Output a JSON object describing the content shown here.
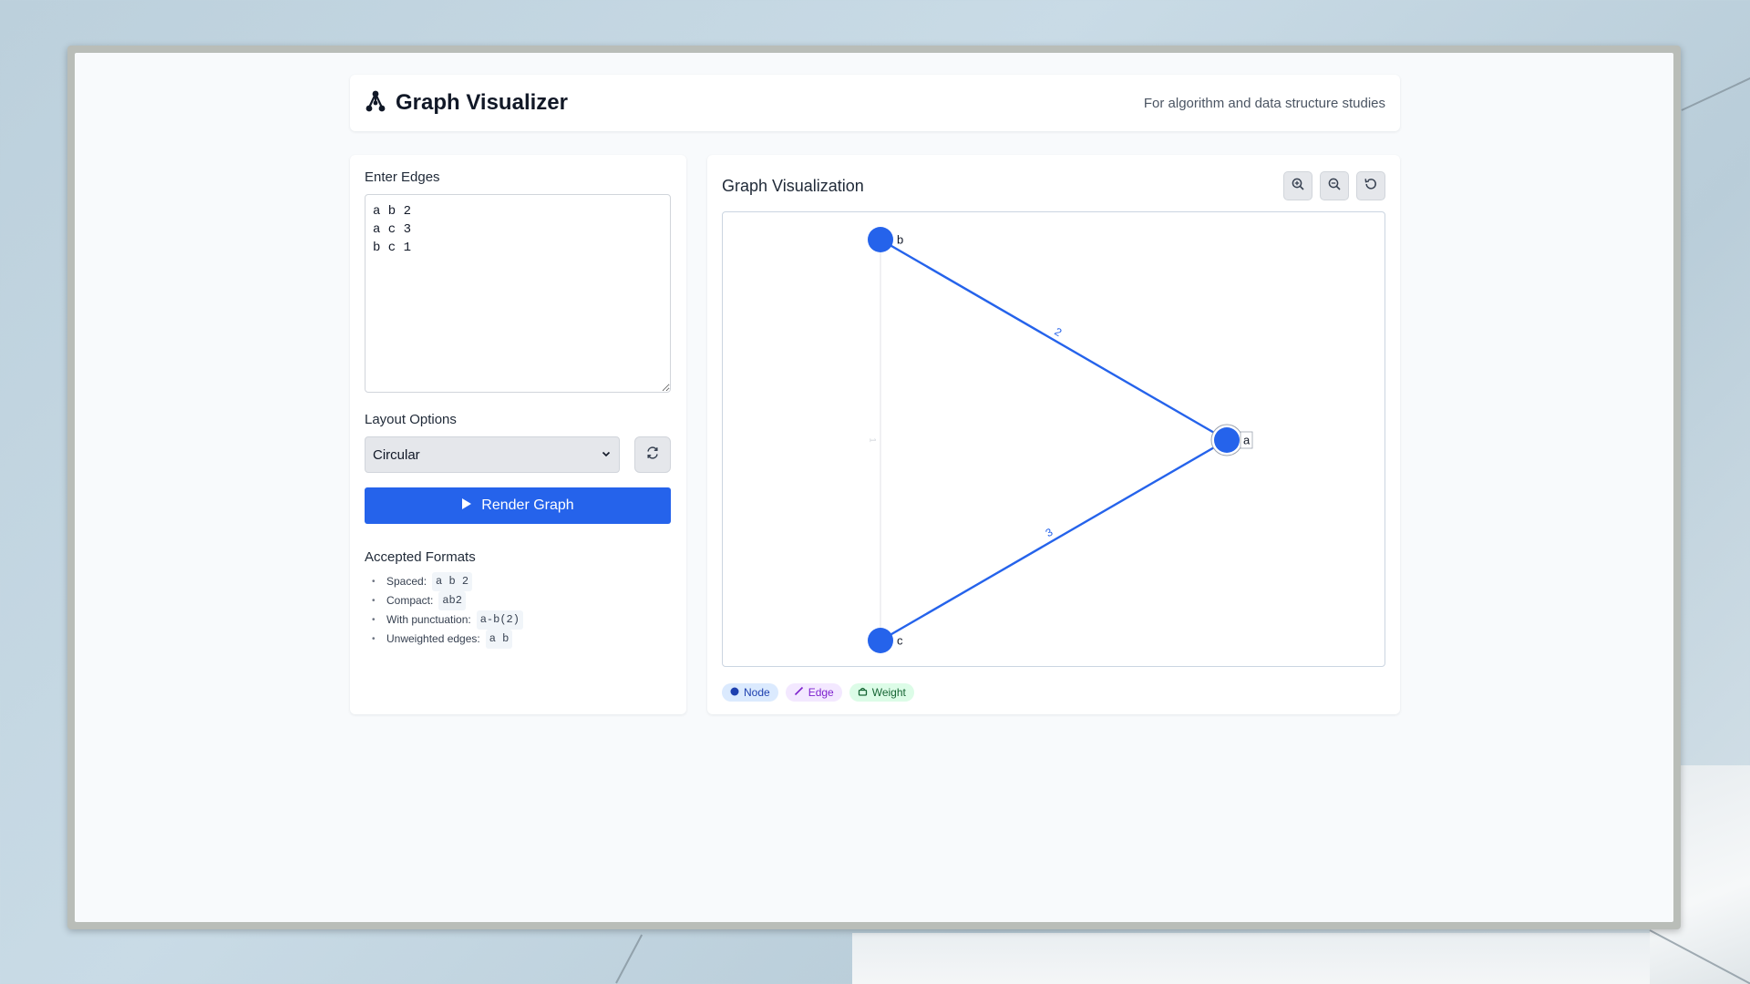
{
  "app": {
    "title": "Graph Visualizer",
    "subtitle": "For algorithm and data structure studies"
  },
  "input_panel": {
    "edges_label": "Enter Edges",
    "edges_value": "a b 2\na c 3\nb c 1",
    "layout_label": "Layout Options",
    "layout_selected": "Circular",
    "render_label": "Render Graph",
    "formats_title": "Accepted Formats",
    "formats": [
      {
        "label": "Spaced:",
        "example": "a b 2"
      },
      {
        "label": "Compact:",
        "example": "ab2"
      },
      {
        "label": "With punctuation:",
        "example": "a-b(2)"
      },
      {
        "label": "Unweighted edges:",
        "example": "a b"
      }
    ]
  },
  "viz_panel": {
    "title": "Graph Visualization",
    "legend": {
      "node": "Node",
      "edge": "Edge",
      "weight": "Weight"
    }
  },
  "graph": {
    "layout": "circular",
    "highlighted_node": "a",
    "nodes": [
      {
        "id": "a"
      },
      {
        "id": "b"
      },
      {
        "id": "c"
      }
    ],
    "edges": [
      {
        "source": "a",
        "target": "b",
        "weight": "2",
        "highlight": true
      },
      {
        "source": "a",
        "target": "c",
        "weight": "3",
        "highlight": true
      },
      {
        "source": "b",
        "target": "c",
        "weight": "1",
        "highlight": false
      }
    ]
  },
  "colors": {
    "accent": "#2563eb",
    "edge_faded": "#e5e7eb"
  },
  "icons": {
    "brand": "graph-nodes-icon",
    "refresh": "refresh-icon",
    "play": "play-icon",
    "zoom_in": "zoom-in-icon",
    "zoom_out": "zoom-out-icon",
    "reset": "reset-view-icon"
  }
}
